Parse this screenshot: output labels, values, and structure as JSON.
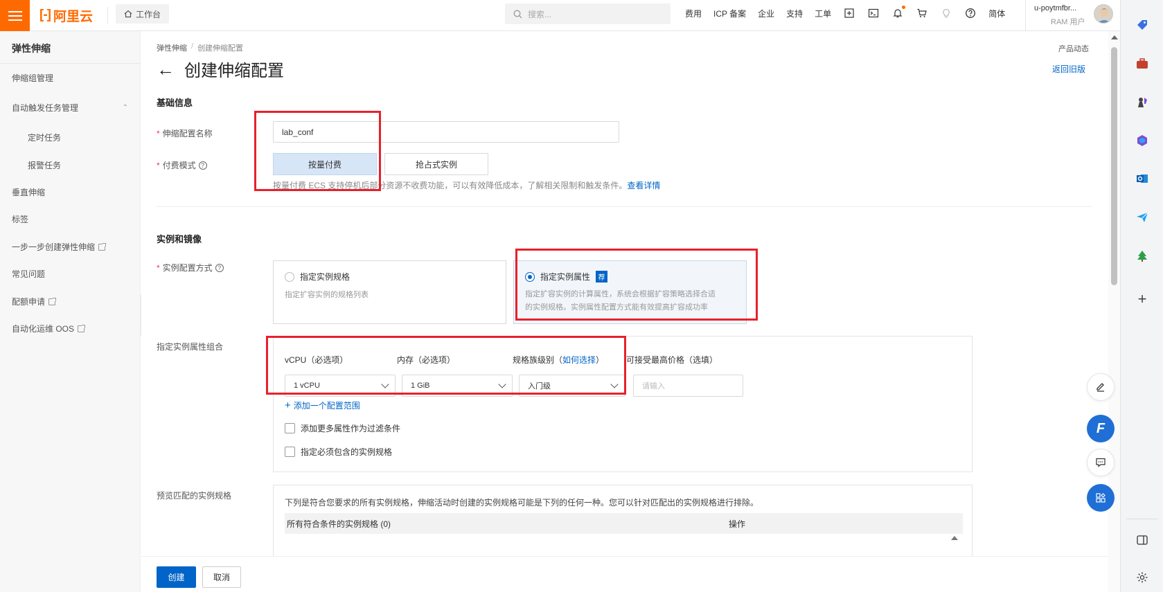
{
  "topbar": {
    "logo_text": "阿里云",
    "workbench": "工作台",
    "search_placeholder": "搜索...",
    "links": [
      "费用",
      "ICP 备案",
      "企业",
      "支持",
      "工单"
    ],
    "lang": "简体",
    "user_name": "u-poytmfbr...",
    "user_role": "RAM 用户"
  },
  "sidebar": {
    "title": "弹性伸缩",
    "items": [
      {
        "label": "伸缩组管理"
      },
      {
        "label": "自动触发任务管理"
      },
      {
        "label": "定时任务"
      },
      {
        "label": "报警任务"
      },
      {
        "label": "垂直伸缩"
      },
      {
        "label": "标签"
      },
      {
        "label": "一步一步创建弹性伸缩"
      },
      {
        "label": "常见问题"
      },
      {
        "label": "配额申请"
      },
      {
        "label": "自动化运维 OOS"
      }
    ]
  },
  "breadcrumb": {
    "root": "弹性伸缩",
    "sep": "/",
    "current": "创建伸缩配置"
  },
  "page": {
    "title": "创建伸缩配置",
    "product_news": "产品动态",
    "old_version": "返回旧版"
  },
  "basic": {
    "section_title": "基础信息",
    "name_label": "伸缩配置名称",
    "name_value": "lab_conf",
    "pay_label": "付费模式",
    "pay_options": [
      "按量付费",
      "抢占式实例"
    ],
    "pay_selected": "按量付费",
    "pay_note": "按量付费 ECS 支持停机后部分资源不收费功能，可以有效降低成本，了解相关限制和触发条件。",
    "pay_link": "查看详情"
  },
  "instance": {
    "section_title": "实例和镜像",
    "mode_label": "实例配置方式",
    "option1_title": "指定实例规格",
    "option1_desc": "指定扩容实例的规格列表",
    "option2_title": "指定实例属性",
    "option2_badge": "荐",
    "option2_desc1": "指定扩容实例的计算属性，系统会根据扩容策略选择合适",
    "option2_desc2": "的实例规格。实例属性配置方式能有效提高扩容成功率",
    "selected": "指定实例属性",
    "attr_label": "指定实例属性组合",
    "vcpu_label": "vCPU（必选项）",
    "vcpu_value": "1 vCPU",
    "mem_label": "内存（必选项）",
    "mem_value": "1 GiB",
    "family_label": "规格族级别（",
    "family_link": "如何选择",
    "family_label_end": "）",
    "family_value": "入门级",
    "price_label": "可接受最高价格（选填）",
    "price_placeholder": "请输入",
    "add_range": "添加一个配置范围",
    "cb_more_filters": "添加更多属性作为过滤条件",
    "cb_must_include": "指定必须包含的实例规格",
    "preview_label": "预览匹配的实例规格",
    "preview_note": "下列是符合您要求的所有实例规格，伸缩活动时创建的实例规格可能是下列的任何一种。您可以针对匹配出的实例规格进行排除。",
    "table_col1": "所有符合条件的实例规格 (0)",
    "table_col2": "操作"
  },
  "footer": {
    "create": "创建",
    "cancel": "取消"
  },
  "colors": {
    "accent_orange": "#ff6a00",
    "primary_blue": "#0064c8",
    "highlight_red": "#e8202b"
  }
}
